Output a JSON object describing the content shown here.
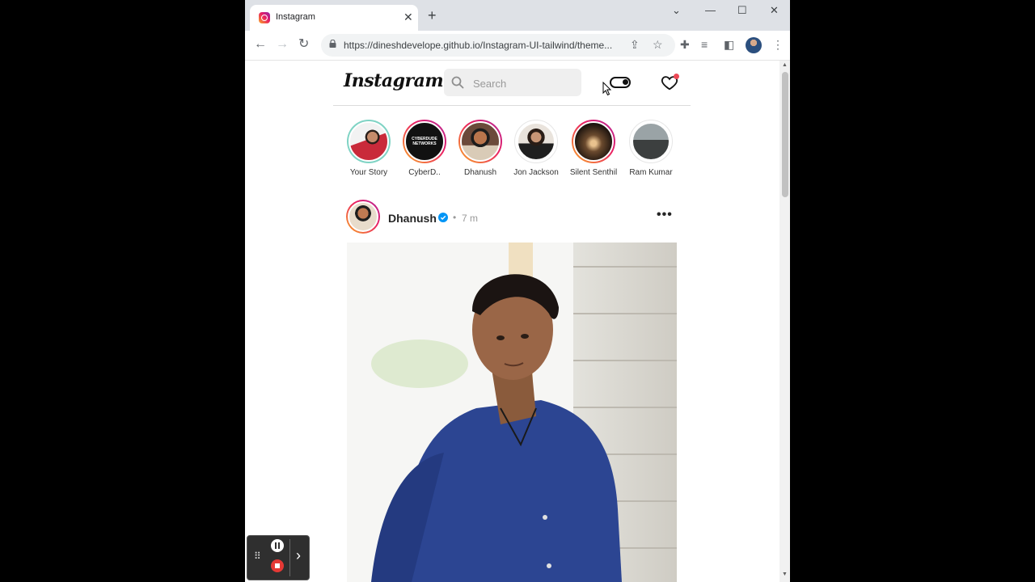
{
  "browser": {
    "tab_title": "Instagram",
    "tab_close": "✕",
    "new_tab": "+",
    "url": "https://dineshdevelope.github.io/Instagram-UI-tailwind/theme...",
    "window_controls": {
      "dropdown": "⌄",
      "minimize": "—",
      "maximize": "☐",
      "close": "✕"
    }
  },
  "header": {
    "logo": "Instagram",
    "search_placeholder": "Search"
  },
  "stories": [
    {
      "label": "Your Story"
    },
    {
      "label": "CyberD..",
      "thumb_text": "CYBERDUDE\nNETWORKS"
    },
    {
      "label": "Dhanush"
    },
    {
      "label": "Jon Jackson"
    },
    {
      "label": "Silent Senthil"
    },
    {
      "label": "Ram Kumar"
    }
  ],
  "post": {
    "username": "Dhanush",
    "separator": "•",
    "time": "7 m",
    "more": "•••"
  },
  "colors": {
    "accent_gradient": [
      "#f9a825",
      "#e91e63",
      "#b12a9b"
    ],
    "verified": "#0095f6",
    "notification": "#ed4956"
  }
}
